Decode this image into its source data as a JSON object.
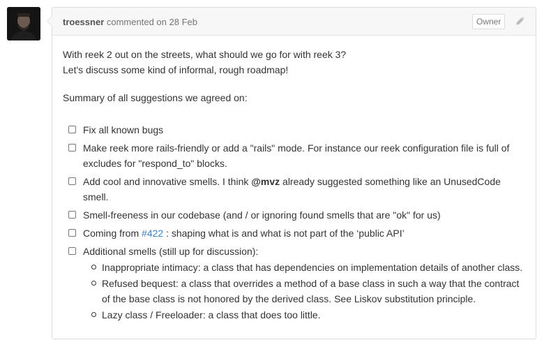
{
  "comment": {
    "author": "troessner",
    "action": "commented on",
    "date": "28 Feb",
    "badge": "Owner",
    "intro_line1": "With reek 2 out on the streets, what should we go for with reek 3?",
    "intro_line2": "Let's discuss some kind of informal, rough roadmap!",
    "summary": "Summary of all suggestions we agreed on:",
    "tasks": [
      {
        "text": "Fix all known bugs"
      },
      {
        "text": "Make reek more rails-friendly or add a \"rails\" mode. For instance our reek configuration file is full of excludes for \"respond_to\" blocks."
      },
      {
        "before": "Add cool and innovative smells. I think ",
        "mention": "@mvz",
        "after": " already suggested something like an UnusedCode smell."
      },
      {
        "text": "Smell-freeness in our codebase (and / or ignoring found smells that are \"ok\" for us)"
      },
      {
        "before": "Coming from ",
        "link": "#422",
        "after": " : shaping what is and what is not part of the ‘public API’"
      },
      {
        "text": "Additional smells (still up for discussion):"
      }
    ],
    "subitems": [
      "Inappropriate intimacy: a class that has dependencies on implementation details of another class.",
      "Refused bequest: a class that overrides a method of a base class in such a way that the contract of the base class is not honored by the derived class. See Liskov substitution principle.",
      "Lazy class / Freeloader: a class that does too little."
    ]
  },
  "icons": {
    "avatar": "user-avatar",
    "edit": "pencil-icon",
    "checkbox": "checkbox-icon",
    "bullet": "circle-bullet-icon"
  },
  "colors": {
    "link": "#4183c4",
    "header_bg": "#f7f7f7",
    "border": "#dddddd"
  }
}
